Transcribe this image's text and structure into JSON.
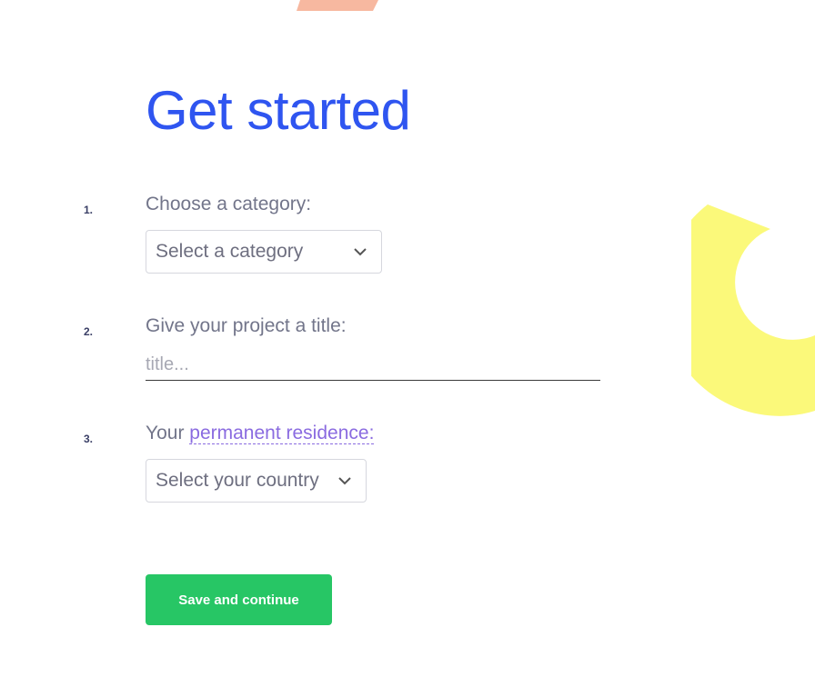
{
  "page": {
    "title": "Get started"
  },
  "steps": [
    {
      "number": "1.",
      "label": "Choose a category:",
      "select_value": "Select a category"
    },
    {
      "number": "2.",
      "label": "Give your project a title:",
      "placeholder": "title..."
    },
    {
      "number": "3.",
      "label_prefix": "Your",
      "label_link": "permanent residence:",
      "select_value": "Select your country"
    }
  ],
  "actions": {
    "save_label": "Save and continue"
  },
  "colors": {
    "title": "#2f55f0",
    "accent_link": "#8a6be0",
    "primary_button": "#27c665",
    "deco_coral": "#f7b8a0",
    "deco_yellow": "#fbf97a"
  },
  "icons": {
    "dropdown": "chevron-down-icon"
  }
}
